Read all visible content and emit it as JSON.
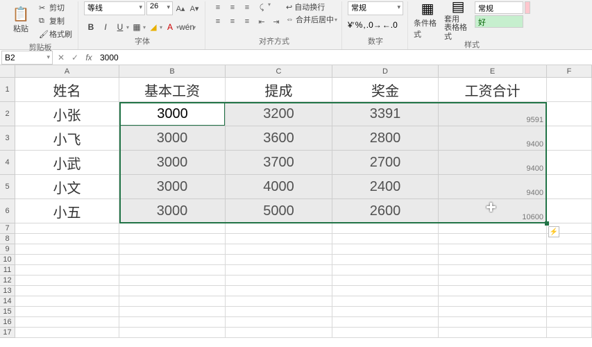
{
  "ribbon": {
    "clipboard": {
      "paste": "粘贴",
      "cut": "剪切",
      "copy": "复制",
      "fmt_painter": "格式刷",
      "label": "剪贴板"
    },
    "font": {
      "name": "等线",
      "size": "26",
      "bold": "B",
      "italic": "I",
      "underline": "U",
      "label": "字体"
    },
    "align": {
      "wrap": "自动换行",
      "merge": "合并后居中",
      "label": "对齐方式"
    },
    "number": {
      "format": "常规",
      "label": "数字"
    },
    "styles": {
      "cond_fmt": "条件格式",
      "table_fmt": "套用\n表格格式",
      "normal": "常规",
      "good": "好",
      "label": "样式"
    }
  },
  "formula_bar": {
    "cell_ref": "B2",
    "value": "3000"
  },
  "sheet": {
    "columns": [
      "A",
      "B",
      "C",
      "D",
      "E",
      "F"
    ],
    "headers": {
      "A": "姓名",
      "B": "基本工资",
      "C": "提成",
      "D": "奖金",
      "E": "工资合计"
    },
    "rows": [
      {
        "name": "小张",
        "base": "3000",
        "comm": "3200",
        "bonus": "3391",
        "total": "9591"
      },
      {
        "name": "小飞",
        "base": "3000",
        "comm": "3600",
        "bonus": "2800",
        "total": "9400"
      },
      {
        "name": "小武",
        "base": "3000",
        "comm": "3700",
        "bonus": "2700",
        "total": "9400"
      },
      {
        "name": "小文",
        "base": "3000",
        "comm": "4000",
        "bonus": "2400",
        "total": "9400"
      },
      {
        "name": "小五",
        "base": "3000",
        "comm": "5000",
        "bonus": "2600",
        "total": "10600"
      }
    ],
    "active_cell_value": "3000"
  },
  "chart_data": {
    "type": "table",
    "columns": [
      "姓名",
      "基本工资",
      "提成",
      "奖金",
      "工资合计"
    ],
    "rows": [
      [
        "小张",
        3000,
        3200,
        3391,
        9591
      ],
      [
        "小飞",
        3000,
        3600,
        2800,
        9400
      ],
      [
        "小武",
        3000,
        3700,
        2700,
        9400
      ],
      [
        "小文",
        3000,
        4000,
        2400,
        9400
      ],
      [
        "小五",
        3000,
        5000,
        2600,
        10600
      ]
    ]
  }
}
